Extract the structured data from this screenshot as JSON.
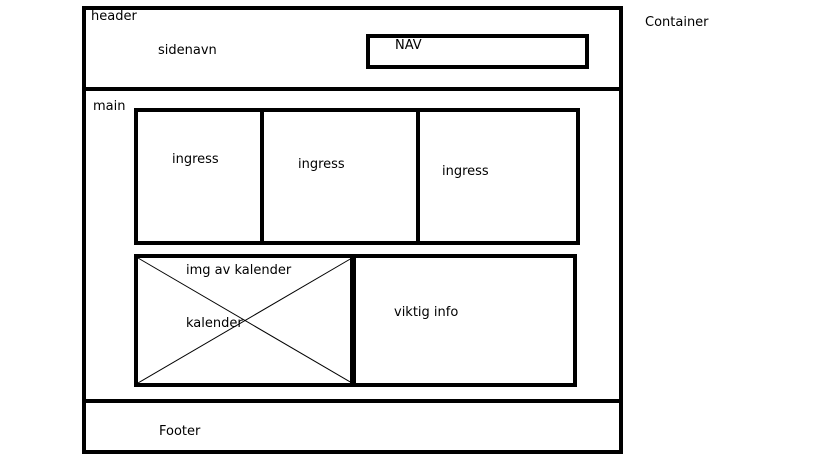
{
  "labels": {
    "container": "Container",
    "header": "header",
    "sidenavn": "sidenavn",
    "nav": "NAV",
    "main": "main",
    "ingress": [
      "ingress",
      "ingress",
      "ingress"
    ],
    "img_av_kalender": "img av kalender",
    "kalender": "kalender",
    "viktig_info": "viktig info",
    "footer": "Footer"
  }
}
